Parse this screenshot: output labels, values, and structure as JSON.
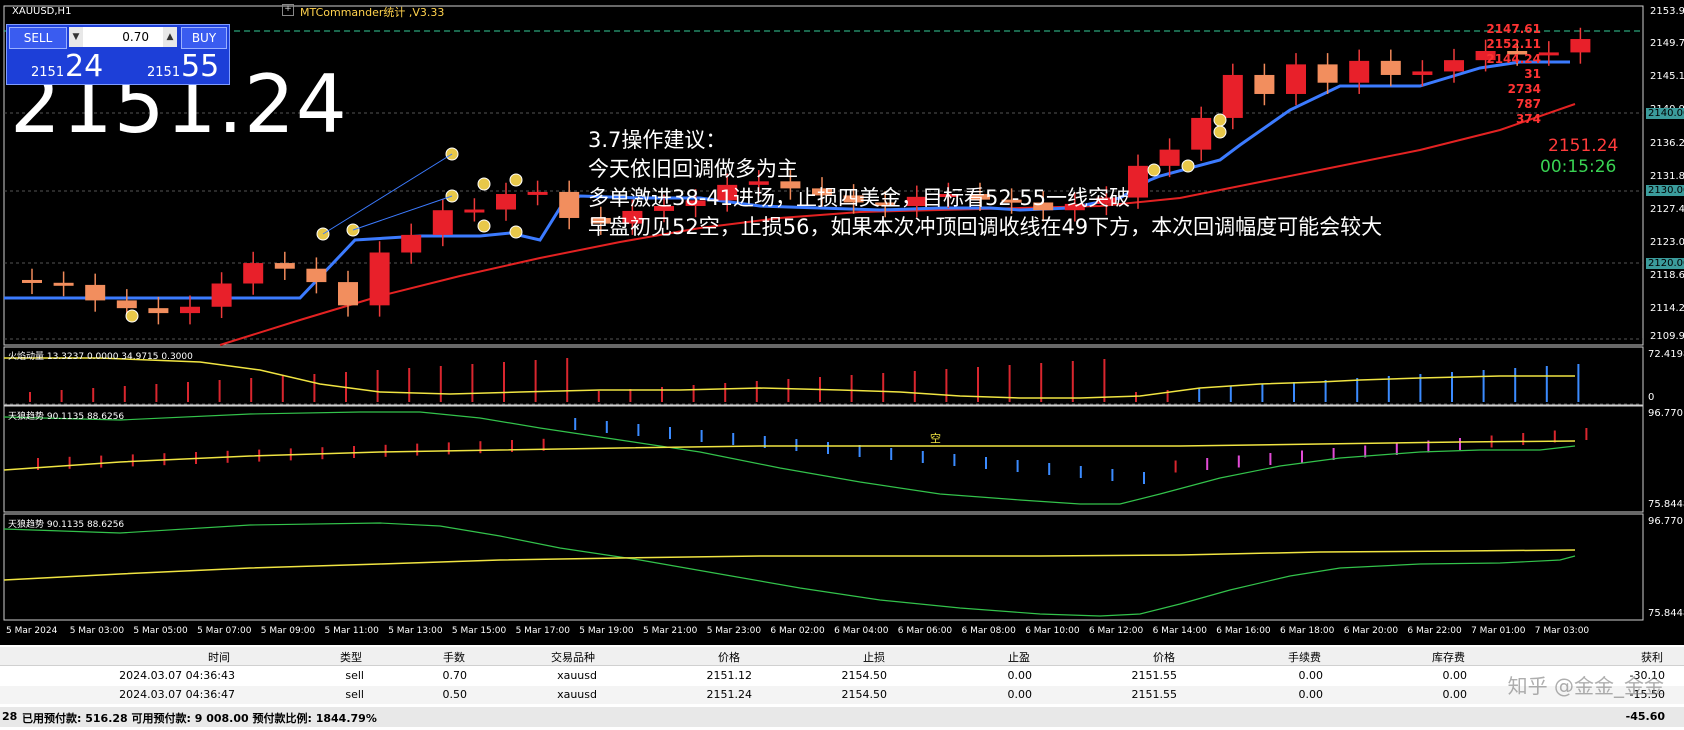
{
  "symbol": "XAUUSD,H1",
  "ea_name": "MTCommander统计 ,V3.33",
  "trade_panel": {
    "sell_label": "SELL",
    "buy_label": "BUY",
    "lot": "0.70",
    "bid_prefix": "2151",
    "bid_big": "24",
    "ask_prefix": "2151",
    "ask_big": "55"
  },
  "big_price": "2151.24",
  "annotation": [
    "3.7操作建议：",
    "今天依旧回调做多为主",
    "多单激进38-41进场，止损四美金，目标看52-55一线突破",
    "早盘初见52空，止损56，如果本次冲顶回调收线在49下方，本次回调幅度可能会较大"
  ],
  "top_right_values": [
    "2147.61",
    "2152.11",
    "2144.24",
    "31",
    "2734",
    "787",
    "374"
  ],
  "current_price": "2151.24",
  "bar_timer": "00:15:26",
  "price_axis": [
    "2153.90",
    "2149.75",
    "2145.10",
    "2140.95",
    "2136.20",
    "2131.85",
    "2127.40",
    "2123.00",
    "2118.60",
    "2114.25",
    "2109.90"
  ],
  "price_tags": [
    "2140.00",
    "2130.00",
    "2120.00",
    "2110.00"
  ],
  "indicator1": {
    "label": "火焰动量 13.3237 0.0000 34.9715 0.3000",
    "axis_top": "72.4198",
    "axis_bottom": "0"
  },
  "indicator2": {
    "label": "天狼趋势 90.1135 88.6256",
    "axis_top": "96.7701",
    "axis_bottom": "75.8448",
    "marker": "空"
  },
  "indicator3": {
    "label": "天狼趋势 90.1135 88.6256",
    "axis_top": "96.7701",
    "axis_bottom": "75.8448"
  },
  "time_axis": [
    "5 Mar 2024",
    "5 Mar 03:00",
    "5 Mar 05:00",
    "5 Mar 07:00",
    "5 Mar 09:00",
    "5 Mar 11:00",
    "5 Mar 13:00",
    "5 Mar 15:00",
    "5 Mar 17:00",
    "5 Mar 19:00",
    "5 Mar 21:00",
    "5 Mar 23:00",
    "6 Mar 02:00",
    "6 Mar 04:00",
    "6 Mar 06:00",
    "6 Mar 08:00",
    "6 Mar 10:00",
    "6 Mar 12:00",
    "6 Mar 14:00",
    "6 Mar 16:00",
    "6 Mar 18:00",
    "6 Mar 20:00",
    "6 Mar 22:00",
    "7 Mar 01:00",
    "7 Mar 03:00"
  ],
  "table": {
    "headers": [
      "时间",
      "类型",
      "手数",
      "交易品种",
      "价格",
      "止损",
      "止盈",
      "价格",
      "手续费",
      "库存费",
      "获利"
    ],
    "rows": [
      [
        "2024.03.07 04:36:43",
        "sell",
        "0.70",
        "xauusd",
        "2151.12",
        "2154.50",
        "0.00",
        "2151.55",
        "0.00",
        "0.00",
        "-30.10"
      ],
      [
        "2024.03.07 04:36:47",
        "sell",
        "0.50",
        "xauusd",
        "2151.24",
        "2154.50",
        "0.00",
        "2151.55",
        "0.00",
        "0.00",
        "-15.50"
      ]
    ],
    "summary": {
      "prefix": "28",
      "text": "已用预付款: 516.28  可用预付款: 9 008.00  预付款比例: 1844.79%",
      "total": "-45.60"
    }
  },
  "watermark": "知乎 @金金_金金",
  "chart_data": {
    "type": "candlestick",
    "series": [
      {
        "name": "XAUUSD H1",
        "close": [
          2116.6,
          2116.3,
          2114.1,
          2113.0,
          2112.3,
          2113.2,
          2116.5,
          2119.4,
          2118.6,
          2116.7,
          2113.4,
          2120.9,
          2123.4,
          2126.9,
          2127.0,
          2129.2,
          2129.5,
          2125.8,
          2125.0,
          2126.8,
          2127.5,
          2128.3,
          2130.5,
          2131.0,
          2130.0,
          2129.0,
          2128.0,
          2127.5,
          2128.8,
          2129.2,
          2128.4,
          2128.0,
          2126.9,
          2127.8,
          2128.7,
          2133.2,
          2135.5,
          2140.0,
          2146.1,
          2143.4,
          2147.6,
          2145.0,
          2148.1,
          2146.1,
          2146.6,
          2148.2,
          2149.5,
          2149.0,
          2149.3,
          2151.2
        ]
      }
    ]
  }
}
